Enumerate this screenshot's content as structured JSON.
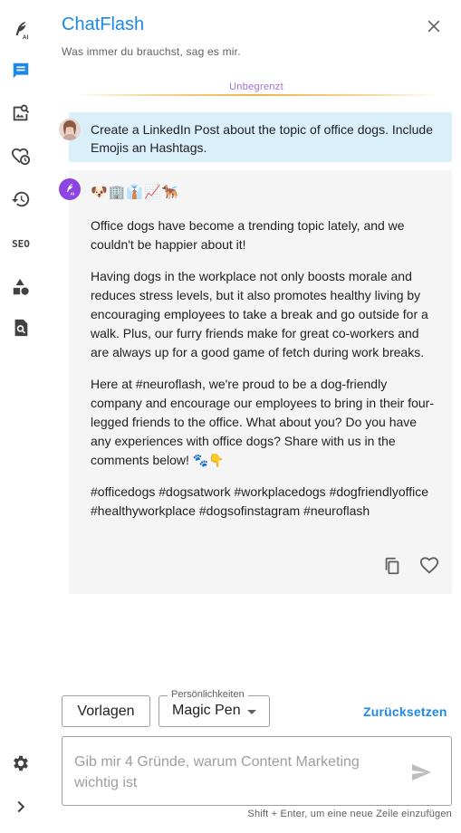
{
  "app": {
    "title": "ChatFlash",
    "subtitle": "Was immer du brauchst, sag es mir.",
    "plan_label": "Unbegrenzt"
  },
  "sidebar": {
    "items": [
      {
        "icon": "quill-ai-icon"
      },
      {
        "icon": "chat-icon",
        "active": true
      },
      {
        "icon": "image-search-icon"
      },
      {
        "icon": "heart-clock-icon"
      },
      {
        "icon": "history-icon"
      },
      {
        "label": "SEO",
        "icon": "seo-icon"
      },
      {
        "icon": "shapes-icon"
      },
      {
        "icon": "document-search-icon"
      }
    ],
    "bottom": [
      {
        "icon": "gear-icon"
      },
      {
        "icon": "chevron-right-icon"
      }
    ]
  },
  "conversation": {
    "user_message": "Create a LinkedIn Post about the topic of office dogs. Include Emojis an Hashtags.",
    "ai_emojis": "🐶🏢👔📈🐕‍🦺",
    "ai_paragraphs": [
      "Office dogs have become a trending topic lately, and we couldn't be happier about it!",
      "Having dogs in the workplace not only boosts morale and reduces stress levels, but it also promotes healthy living by encouraging employees to take a break and go outside for a walk. Plus, our furry friends make for great co-workers and are always up for a good game of fetch during work breaks.",
      "Here at #neuroflash, we're proud to be a dog-friendly company and encourage our employees to bring in their four-legged friends to the office. What about you? Do you have any experiences with office dogs? Share with us in the comments below! 🐾👇",
      "#officedogs #dogsatwork #workplacedogs #dogfriendlyoffice #healthyworkplace #dogsofinstagram #neuroflash"
    ]
  },
  "controls": {
    "templates_label": "Vorlagen",
    "persona_label": "Persönlichkeiten",
    "persona_value": "Magic Pen",
    "reset_label": "Zurücksetzen"
  },
  "input": {
    "placeholder": "Gib mir 4 Gründe, warum Content Marketing wichtig ist",
    "value": "",
    "hint": "Shift + Enter, um eine neue Zeile einzufügen"
  },
  "colors": {
    "accent": "#1e88e5",
    "plan": "#a66ed6",
    "user_bubble": "#d9f0fb",
    "ai_bubble": "#f5f5f5",
    "ai_avatar": "#8e44e0"
  }
}
